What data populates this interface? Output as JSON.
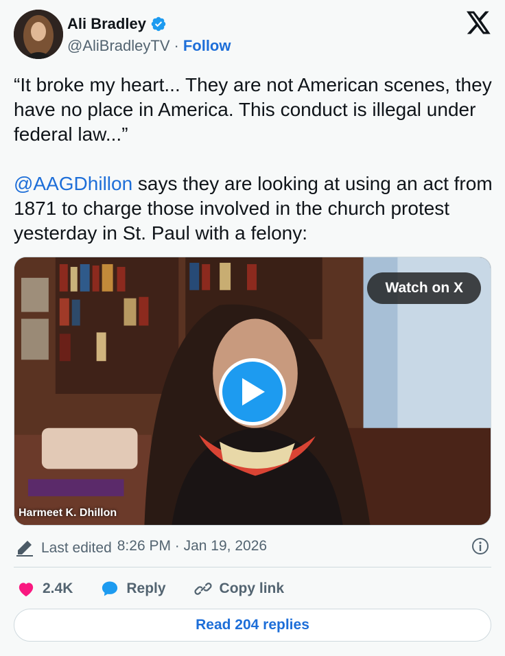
{
  "author": {
    "name": "Ali Bradley",
    "handle": "@AliBradleyTV",
    "separator": "·",
    "follow_label": "Follow",
    "verified_color": "#1d9bf0"
  },
  "tweet": {
    "quote_text": "“It broke my heart... They are not American scenes, they have no place in America. This conduct is illegal under federal law...”",
    "mention": "@AAGDhillon",
    "body_after_mention": " says they are looking at using an act from 1871 to charge those involved in the church protest yesterday in St. Paul with a felony:"
  },
  "video": {
    "watch_label": "Watch on X",
    "caption": "Harmeet K. Dhillon"
  },
  "meta": {
    "edited_label": "Last edited",
    "timestamp": "8:26 PM · Jan 19, 2026"
  },
  "actions": {
    "like_count": "2.4K",
    "reply_label": "Reply",
    "copy_label": "Copy link",
    "read_replies_label": "Read 204 replies"
  },
  "colors": {
    "link": "#1d6ed8",
    "like": "#f91880",
    "play": "#1d9bf0"
  },
  "icons": [
    "verified-badge-icon",
    "x-logo-icon",
    "play-icon",
    "pencil-icon",
    "info-icon",
    "heart-icon",
    "reply-bubble-icon",
    "link-icon"
  ]
}
